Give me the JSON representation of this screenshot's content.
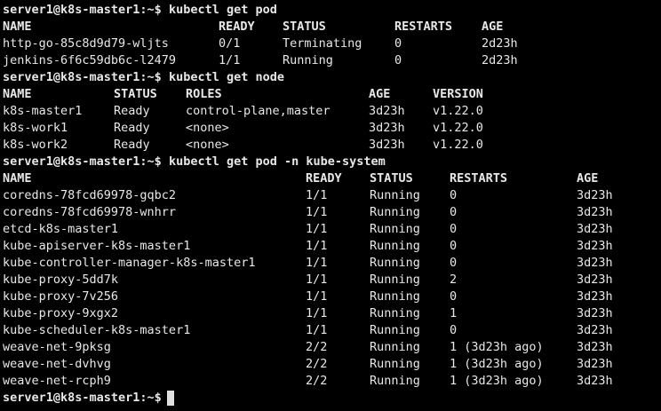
{
  "prompt": "server1@k8s-master1:~$",
  "commands": {
    "get_pod": "kubectl get pod",
    "get_node": "kubectl get node",
    "get_pod_kube_system": "kubectl get pod -n kube-system"
  },
  "pods": {
    "headers": [
      "NAME",
      "READY",
      "STATUS",
      "RESTARTS",
      "AGE"
    ],
    "rows": [
      [
        "http-go-85c8d9d79-wljts",
        "0/1",
        "Terminating",
        "0",
        "2d23h"
      ],
      [
        "jenkins-6f6c59db6c-l2479",
        "1/1",
        "Running",
        "0",
        "2d23h"
      ]
    ]
  },
  "nodes": {
    "headers": [
      "NAME",
      "STATUS",
      "ROLES",
      "AGE",
      "VERSION"
    ],
    "rows": [
      [
        "k8s-master1",
        "Ready",
        "control-plane,master",
        "3d23h",
        "v1.22.0"
      ],
      [
        "k8s-work1",
        "Ready",
        "<none>",
        "3d23h",
        "v1.22.0"
      ],
      [
        "k8s-work2",
        "Ready",
        "<none>",
        "3d23h",
        "v1.22.0"
      ]
    ]
  },
  "kube_system_pods": {
    "headers": [
      "NAME",
      "READY",
      "STATUS",
      "RESTARTS",
      "AGE"
    ],
    "rows": [
      [
        "coredns-78fcd69978-gqbc2",
        "1/1",
        "Running",
        "0",
        "3d23h"
      ],
      [
        "coredns-78fcd69978-wnhrr",
        "1/1",
        "Running",
        "0",
        "3d23h"
      ],
      [
        "etcd-k8s-master1",
        "1/1",
        "Running",
        "0",
        "3d23h"
      ],
      [
        "kube-apiserver-k8s-master1",
        "1/1",
        "Running",
        "0",
        "3d23h"
      ],
      [
        "kube-controller-manager-k8s-master1",
        "1/1",
        "Running",
        "0",
        "3d23h"
      ],
      [
        "kube-proxy-5dd7k",
        "1/1",
        "Running",
        "2",
        "3d23h"
      ],
      [
        "kube-proxy-7v256",
        "1/1",
        "Running",
        "0",
        "3d23h"
      ],
      [
        "kube-proxy-9xgx2",
        "1/1",
        "Running",
        "1",
        "3d23h"
      ],
      [
        "kube-scheduler-k8s-master1",
        "1/1",
        "Running",
        "0",
        "3d23h"
      ],
      [
        "weave-net-9pksg",
        "2/2",
        "Running",
        "1 (3d23h ago)",
        "3d23h"
      ],
      [
        "weave-net-dvhvg",
        "2/2",
        "Running",
        "1 (3d23h ago)",
        "3d23h"
      ],
      [
        "weave-net-rcph9",
        "2/2",
        "Running",
        "1 (3d23h ago)",
        "3d23h"
      ]
    ]
  },
  "colors": {
    "background": "#000000",
    "foreground": "#e8e8e8",
    "cursor": "#e0e0e0"
  }
}
